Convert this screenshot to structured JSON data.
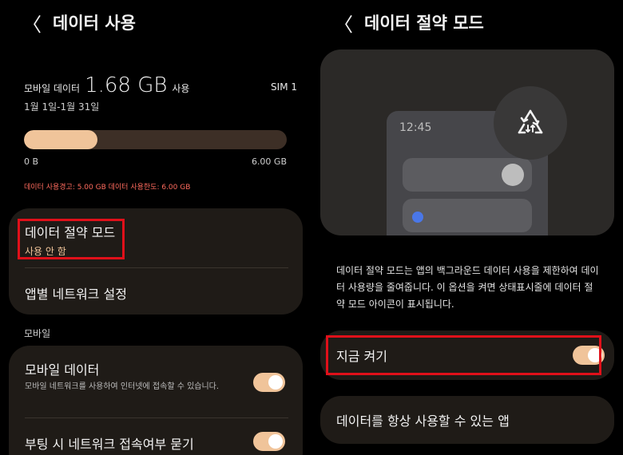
{
  "left": {
    "header": {
      "back_glyph": "〈",
      "title": "데이터 사용"
    },
    "usage": {
      "label": "모바일 데이터",
      "value": "1.68 GB",
      "suffix": "사용",
      "sim": "SIM 1",
      "date_range": "1월 1일-1월 31일",
      "progress_fraction": 0.28,
      "min_label": "0 B",
      "max_label": "6.00 GB",
      "limits": "데이터 사용경고: 5.00 GB  데이터 사용한도: 6.00 GB"
    },
    "data_saver": {
      "title": "데이터 절약 모드",
      "status": "사용 안 함"
    },
    "app_network": "앱별 네트워크 설정",
    "section_mobile": "모바일",
    "mobile_data": {
      "title": "모바일 데이터",
      "desc": "모바일 네트워크를 사용하여 인터넷에 접속할 수 있습니다.",
      "enabled": true
    },
    "boot_network": {
      "title": "부팅 시 네트워크 접속여부 묻기",
      "enabled": true
    }
  },
  "right": {
    "header": {
      "back_glyph": "〈",
      "title": "데이터 절약 모드"
    },
    "illustration": {
      "time": "12:45",
      "icon": "data-saver-recycle-icon"
    },
    "description": "데이터 절약 모드는 앱의 백그라운드 데이터 사용을 제한하여 데이터 사용량을 줄여줍니다. 이 옵션을 켜면 상태표시줄에 데이터 절약 모드 아이콘이 표시됩니다.",
    "turn_on_now": {
      "label": "지금 켜기",
      "enabled": true
    },
    "always_allowed_apps": "데이터를 항상 사용할 수 있는 앱"
  },
  "colors": {
    "accent": "#f0c49a",
    "warning": "#ff6b5e",
    "highlight": "#e0101a",
    "card": "#1f1b17"
  }
}
